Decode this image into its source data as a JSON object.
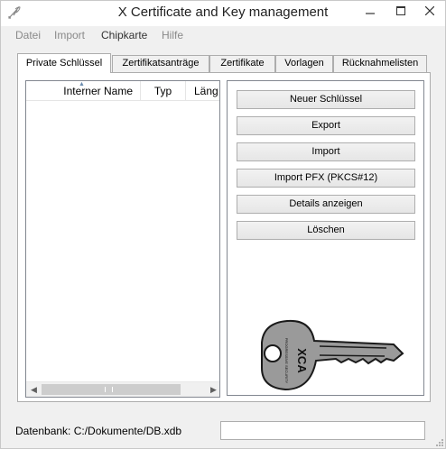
{
  "window": {
    "title": "X Certificate and Key management",
    "minimize_glyph": "—",
    "maximize_glyph": "☐",
    "close_glyph": "✕"
  },
  "menu": {
    "items": [
      {
        "label": "Datei"
      },
      {
        "label": "Import"
      },
      {
        "label": "Chipkarte"
      },
      {
        "label": "Hilfe"
      }
    ]
  },
  "tabs": [
    {
      "label": "Private Schlüssel",
      "selected": true
    },
    {
      "label": "Zertifikatsanträge"
    },
    {
      "label": "Zertifikate"
    },
    {
      "label": "Vorlagen"
    },
    {
      "label": "Rücknahmelisten"
    }
  ],
  "key_list": {
    "columns": [
      {
        "label": "Interner Name"
      },
      {
        "label": "Typ"
      },
      {
        "label": "Läng"
      }
    ],
    "sort_indicator": "▲",
    "rows": []
  },
  "scroll": {
    "left_glyph": "◀",
    "right_glyph": "▶"
  },
  "actions": {
    "new_key": "Neuer Schlüssel",
    "export": "Export",
    "import": "Import",
    "import_pfx": "Import PFX (PKCS#12)",
    "details": "Details anzeigen",
    "delete": "Löschen"
  },
  "status": {
    "database_label": "Datenbank: C:/Dokumente/DB.xdb",
    "field_value": ""
  },
  "logo": {
    "key_text": "XCA",
    "key_small_text": "PROGRESSIVE SECURITY"
  },
  "icons": {
    "app": "quill-pen-icon",
    "minimize": "minimize-icon",
    "maximize": "maximize-icon",
    "close": "close-icon"
  }
}
